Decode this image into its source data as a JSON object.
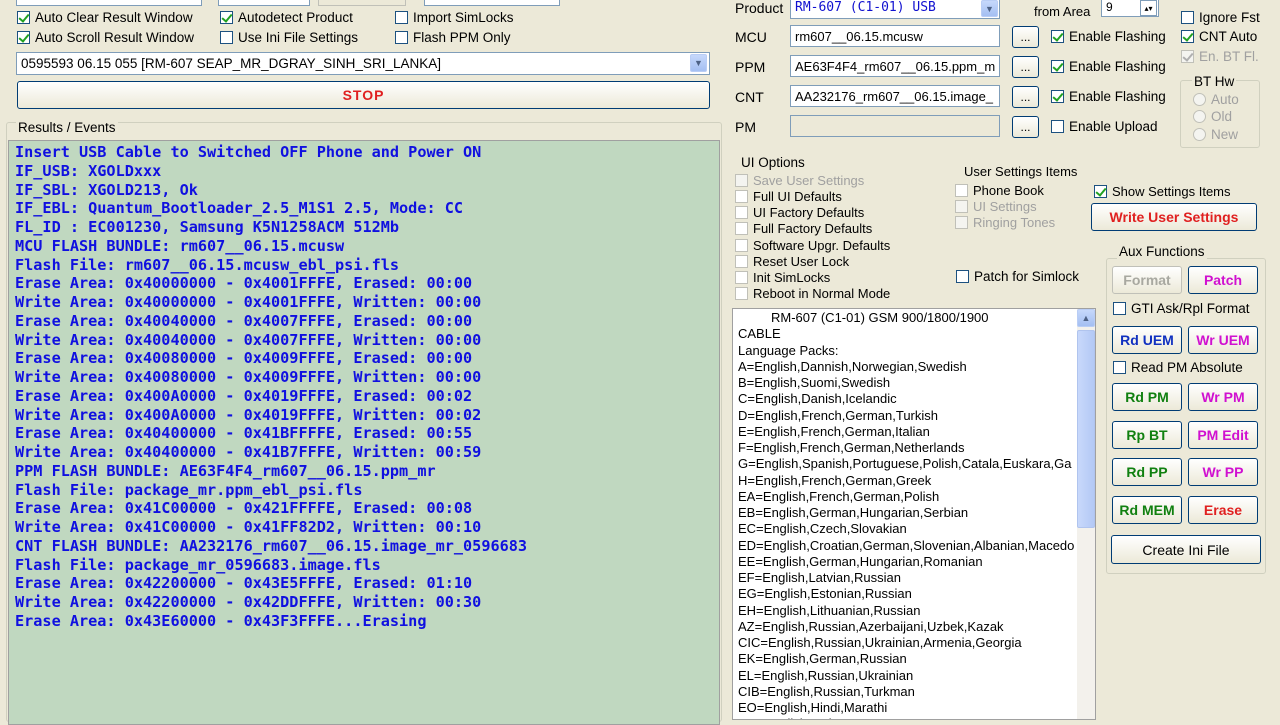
{
  "options": {
    "auto_clear": "Auto Clear Result Window",
    "auto_scroll": "Auto Scroll Result Window",
    "autodetect": "Autodetect Product",
    "use_ini": "Use Ini File Settings",
    "import_simlocks": "Import SimLocks",
    "flash_ppm_only": "Flash PPM Only"
  },
  "firmware_select": {
    "value": "0595593 06.15 055  [RM-607 SEAP_MR_DGRAY_SINH_SRI_LANKA]"
  },
  "stop_button": "STOP",
  "results": {
    "title": "Results / Events",
    "lines": [
      "Insert USB Cable to Switched OFF Phone and Power ON",
      "IF_USB: XGOLDxxx",
      "IF_SBL: XGOLD213, Ok",
      "IF_EBL: Quantum_Bootloader_2.5_M1S1 2.5, Mode: CC",
      "FL_ID : EC001230, Samsung K5N1258ACM 512Mb",
      "MCU FLASH BUNDLE: rm607__06.15.mcusw",
      "Flash File: rm607__06.15.mcusw_ebl_psi.fls",
      "Erase Area: 0x40000000 - 0x4001FFFE, Erased: 00:00",
      "Write Area: 0x40000000 - 0x4001FFFE, Written: 00:00",
      "Erase Area: 0x40040000 - 0x4007FFFE, Erased: 00:00",
      "Write Area: 0x40040000 - 0x4007FFFE, Written: 00:00",
      "Erase Area: 0x40080000 - 0x4009FFFE, Erased: 00:00",
      "Write Area: 0x40080000 - 0x4009FFFE, Written: 00:00",
      "Erase Area: 0x400A0000 - 0x4019FFFE, Erased: 00:02",
      "Write Area: 0x400A0000 - 0x4019FFFE, Written: 00:02",
      "Erase Area: 0x40400000 - 0x41BFFFFE, Erased: 00:55",
      "Write Area: 0x40400000 - 0x41B7FFFE, Written: 00:59",
      "PPM FLASH BUNDLE: AE63F4F4_rm607__06.15.ppm_mr",
      "Flash File: package_mr.ppm_ebl_psi.fls",
      "Erase Area: 0x41C00000 - 0x421FFFFE, Erased: 00:08",
      "Write Area: 0x41C00000 - 0x41FF82D2, Written: 00:10",
      "CNT FLASH BUNDLE: AA232176_rm607__06.15.image_mr_0596683",
      "Flash File: package_mr_0596683.image.fls",
      "Erase Area: 0x42200000 - 0x43E5FFFE, Erased: 01:10",
      "Write Area: 0x42200000 - 0x42DDFFFE, Written: 00:30",
      "Erase Area: 0x43E60000 - 0x43F3FFFE...Erasing"
    ]
  },
  "product": {
    "label": "Product",
    "value": "RM-607  (C1-01) USB",
    "erase_area_label": "from Area",
    "erase_area_value": "9",
    "rows": [
      {
        "label": "MCU",
        "value": "rm607__06.15.mcusw",
        "browse": "...",
        "flag": "Enable Flashing"
      },
      {
        "label": "PPM",
        "value": "AE63F4F4_rm607__06.15.ppm_m",
        "browse": "...",
        "flag": "Enable Flashing"
      },
      {
        "label": "CNT",
        "value": "AA232176_rm607__06.15.image_",
        "browse": "...",
        "flag": "Enable Flashing"
      },
      {
        "label": "PM",
        "value": "",
        "browse": "...",
        "flag": "Enable Upload"
      }
    ]
  },
  "right_opts": {
    "ignore_fst": "Ignore Fst",
    "cnt_auto": "CNT Auto",
    "en_bt_fl": "En. BT Fl.",
    "bt_hw": "BT Hw",
    "bt_auto": "Auto",
    "bt_old": "Old",
    "bt_new": "New"
  },
  "ui_options": {
    "title": "UI Options",
    "items": [
      "Save User Settings",
      "Full UI Defaults",
      "UI Factory Defaults",
      "Full Factory Defaults",
      "Software Upgr. Defaults",
      "Reset User Lock",
      "Init SimLocks",
      "Reboot in Normal Mode"
    ]
  },
  "user_settings": {
    "title": "User Settings Items",
    "phone_book": "Phone Book",
    "ui_settings": "UI Settings",
    "ringing_tones": "Ringing Tones",
    "show_settings": "Show Settings Items",
    "write_button": "Write User Settings",
    "patch_simlock": "Patch for Simlock"
  },
  "phone_info": {
    "lines": [
      "RM-607 (C1-01) GSM 900/1800/1900",
      "CABLE",
      "Language Packs:",
      "A=English,Dannish,Norwegian,Swedish",
      "B=English,Suomi,Swedish",
      "C=English,Danish,Icelandic",
      "D=English,French,German,Turkish",
      "E=English,French,German,Italian",
      "F=English,French,German,Netherlands",
      "G=English,Spanish,Portuguese,Polish,Catala,Euskara,Ga",
      "H=English,French,German,Greek",
      "EA=English,French,German,Polish",
      "EB=English,German,Hungarian,Serbian",
      "EC=English,Czech,Slovakian",
      "ED=English,Croatian,German,Slovenian,Albanian,Macedo",
      "EE=English,German,Hungarian,Romanian",
      "EF=English,Latvian,Russian",
      "EG=English,Estonian,Russian",
      "EH=English,Lithuanian,Russian",
      "AZ=English,Russian,Azerbaijani,Uzbek,Kazak",
      "CIC=English,Russian,Ukrainian,Armenia,Georgia",
      "EK=English,German,Russian",
      "EL=English,Russian,Ukrainian",
      "CIB=English,Russian,Turkman",
      "EO=English,Hindi,Marathi",
      "EQ=English,Urdu,..."
    ]
  },
  "aux": {
    "title": "Aux Functions",
    "format": "Format",
    "patch": "Patch",
    "gti": "GTI Ask/Rpl Format",
    "rd_uem": "Rd UEM",
    "wr_uem": "Wr UEM",
    "read_pm_abs": "Read PM Absolute",
    "rd_pm": "Rd PM",
    "wr_pm": "Wr PM",
    "rp_bt": "Rp BT",
    "pm_edit": "PM Edit",
    "rd_pp": "Rd PP",
    "wr_pp": "Wr PP",
    "rd_mem": "Rd MEM",
    "erase": "Erase",
    "create_ini": "Create Ini File"
  },
  "colors": {
    "log_bg": "#c0d8c0",
    "log_text": "#1010e0",
    "stop_red": "#e02020",
    "green_btn": "#108010",
    "magenta_btn": "#d010d0",
    "blue_btn": "#1030c0",
    "red_btn": "#e02020"
  }
}
